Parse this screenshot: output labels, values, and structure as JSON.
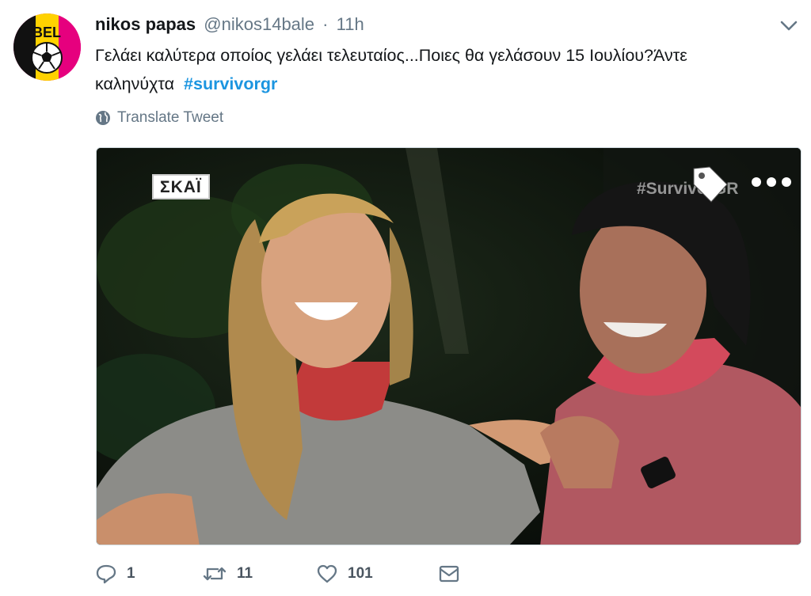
{
  "user": {
    "name": "nikos papas",
    "handle": "@nikos14bale",
    "separator": "·",
    "time": "11h",
    "avatar_text": "BEL"
  },
  "tweet": {
    "text": "Γελάει καλύτερα οποίος γελάει τελευταίος...Ποιες θα γελάσουν 15 Ιουλίου?Άντε καληνύχτα",
    "hashtag": "#survivorgr"
  },
  "translate": {
    "label": "Translate Tweet",
    "icon": "globe-icon"
  },
  "media": {
    "channel_logo": "ΣΚΑΪ",
    "watermark": "#SurvivorGR"
  },
  "actions": {
    "reply_count": "1",
    "retweet_count": "11",
    "like_count": "101"
  },
  "colors": {
    "link": "#1b95e0",
    "secondary": "#657786",
    "avatar_pink": "#e6007e",
    "avatar_yellow": "#ffd200"
  }
}
